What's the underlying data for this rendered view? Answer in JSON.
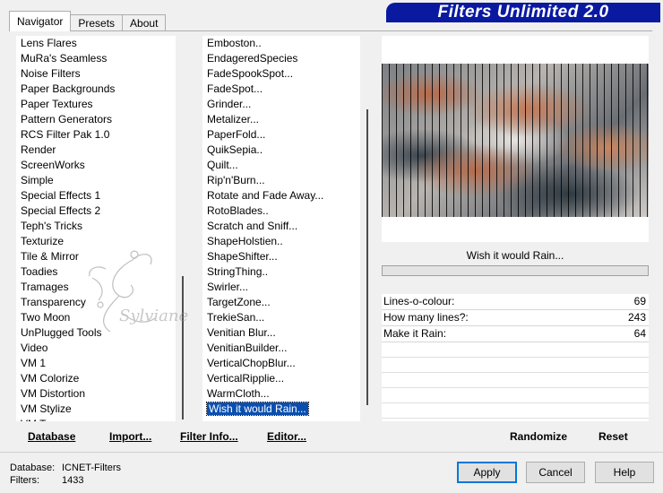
{
  "tabs": [
    "Navigator",
    "Presets",
    "About"
  ],
  "banner_title": "Filters Unlimited 2.0",
  "categories": [
    "Lens Flares",
    "MuRa's Seamless",
    "Noise Filters",
    "Paper Backgrounds",
    "Paper Textures",
    "Pattern Generators",
    "RCS Filter Pak 1.0",
    "Render",
    "ScreenWorks",
    "Simple",
    "Special Effects 1",
    "Special Effects 2",
    "Teph's Tricks",
    "Texturize",
    "Tile & Mirror",
    "Toadies",
    "Tramages",
    "Transparency",
    "Two Moon",
    "UnPlugged Tools",
    "Video",
    "VM 1",
    "VM Colorize",
    "VM Distortion",
    "VM Stylize",
    "VM To..."
  ],
  "filters": [
    "Emboston..",
    "EndageredSpecies",
    "FadeSpookSpot...",
    "FadeSpot...",
    "Grinder...",
    "Metalizer...",
    "PaperFold...",
    "QuikSepia..",
    "Quilt...",
    "Rip'n'Burn...",
    "Rotate and Fade Away...",
    "RotoBlades..",
    "Scratch and Sniff...",
    "ShapeHolstien..",
    "ShapeShifter...",
    "StringThing..",
    "Swirler...",
    "TargetZone...",
    "TrekieSan...",
    "Venitian Blur...",
    "VenitianBuilder...",
    "VerticalChopBlur...",
    "VerticalRipplie...",
    "WarmCloth...",
    "Wish it would Rain..."
  ],
  "selected_filter_index": 24,
  "bottom_buttons": {
    "database": "Database",
    "import": "Import...",
    "filter_info": "Filter Info...",
    "editor": "Editor..."
  },
  "preview": {
    "filter_name": "Wish it would Rain..."
  },
  "params": [
    {
      "label": "Lines-o-colour:",
      "value": "69"
    },
    {
      "label": "How many lines?:",
      "value": "243"
    },
    {
      "label": "Make it Rain:",
      "value": "64"
    }
  ],
  "panel_buttons": {
    "randomize": "Randomize",
    "reset": "Reset"
  },
  "status": {
    "database_label": "Database:",
    "database_value": "ICNET-Filters",
    "filters_label": "Filters:",
    "filters_value": "1433"
  },
  "dialog_buttons": {
    "apply": "Apply",
    "cancel": "Cancel",
    "help": "Help"
  },
  "watermark_text": "Sylviane",
  "colors": {
    "banner": "#0a1aa0",
    "selection": "#0a4fb0",
    "default_button_border": "#0078d7"
  }
}
